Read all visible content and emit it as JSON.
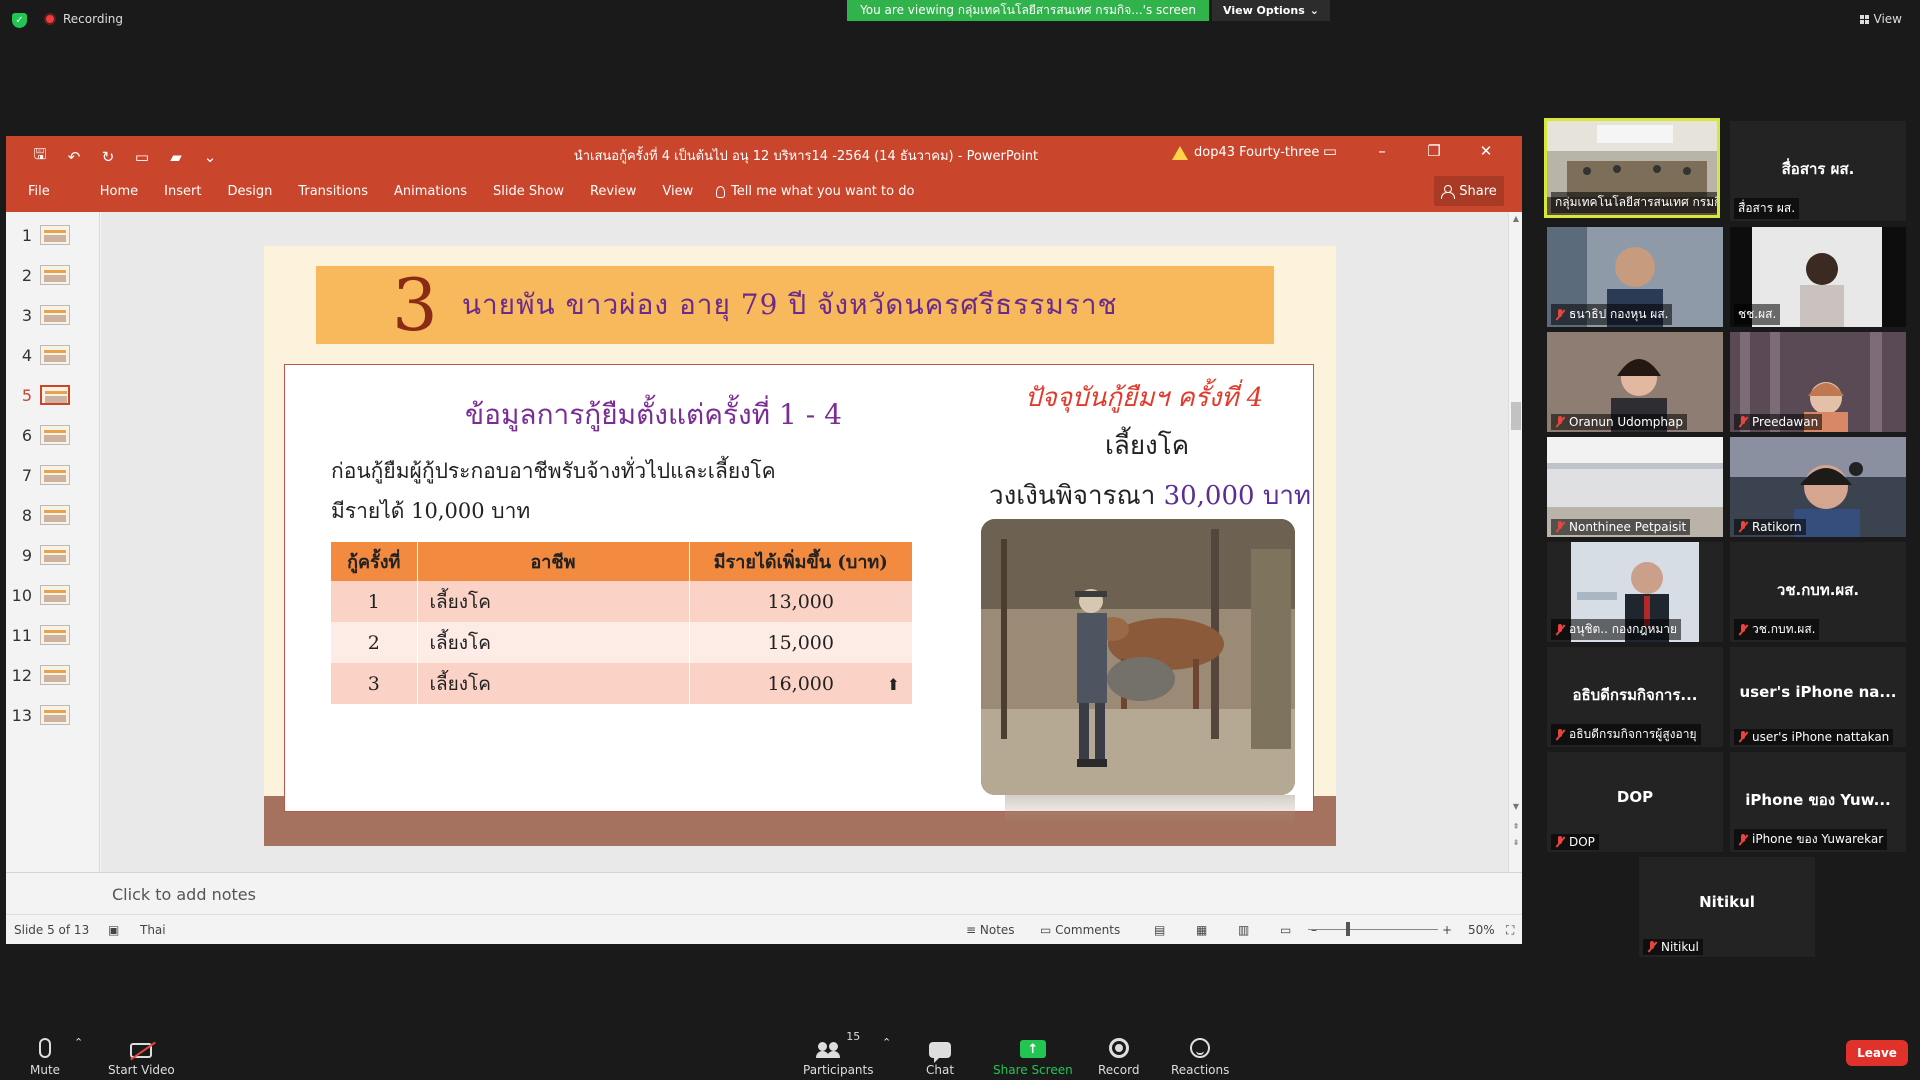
{
  "zoom": {
    "recording_label": "Recording",
    "banner_text": "You are viewing กลุ่มเทคโนโลยีสารสนเทศ กรมกิจ...'s screen",
    "view_options_label": "View Options",
    "view_label": "View",
    "participants_count": "15",
    "toolbar": {
      "mute": "Mute",
      "start_video": "Start Video",
      "participants": "Participants",
      "chat": "Chat",
      "share_screen": "Share Screen",
      "record": "Record",
      "reactions": "Reactions",
      "leave": "Leave"
    },
    "colors": {
      "accent_green": "#2fb34a",
      "leave_red": "#e0322b",
      "active_speaker": "#d8e83a"
    }
  },
  "powerpoint": {
    "doc_title": "นำเสนอกู้ครั้งที่ 4 เป็นต้นไป อนุ 12 บริหาร14 -2564 (14 ธันวาคม)  -  PowerPoint",
    "user": "dop43 Fourty-three",
    "menu": [
      "File",
      "Home",
      "Insert",
      "Design",
      "Transitions",
      "Animations",
      "Slide Show",
      "Review",
      "View"
    ],
    "tell_me": "Tell me what you want to do",
    "share": "Share",
    "slide_numbers": [
      "1",
      "2",
      "3",
      "4",
      "5",
      "6",
      "7",
      "8",
      "9",
      "10",
      "11",
      "12",
      "13"
    ],
    "active_slide": "5",
    "notes_placeholder": "Click to add notes",
    "status": {
      "slide_of": "Slide 5 of 13",
      "language": "Thai",
      "notes": "Notes",
      "comments": "Comments",
      "zoom": "50%"
    },
    "colors": {
      "title_bar": "#c9452c"
    }
  },
  "slide": {
    "number": "3",
    "heading": "นายพัน  ขาวผ่อง  อายุ 79 ปี  จังหวัดนครศรีธรรมราช",
    "subtitle": "ข้อมูลการกู้ยืมตั้งแต่ครั้งที่ 1 - 4",
    "line1": "ก่อนกู้ยืมผู้กู้ประกอบอาชีพรับจ้างทั่วไปและเลี้ยงโค",
    "line2": "มีรายได้  10,000 บาท",
    "table": {
      "headers": [
        "กู้ครั้งที่",
        "อาชีพ",
        "มีรายได้เพิ่มขึ้น  (บาท)"
      ],
      "rows": [
        {
          "no": "1",
          "occupation": "เลี้ยงโค",
          "income": "13,000"
        },
        {
          "no": "2",
          "occupation": "เลี้ยงโค",
          "income": "15,000"
        },
        {
          "no": "3",
          "occupation": "เลี้ยงโค",
          "income": "16,000"
        }
      ]
    },
    "current_label": "ปัจจุบันกู้ยืมฯ ครั้งที่ 4",
    "current_occupation": "เลี้ยงโค",
    "amount_label": "วงเงินพิจารณา",
    "amount_value": "30,000 บาท"
  },
  "participants": [
    {
      "name": "กลุ่มเทคโนโลยีสารสนเทศ กรมกิจ...",
      "type": "video",
      "active": true
    },
    {
      "name": "สื่อสาร ผส.",
      "display": "สื่อสาร ผส.",
      "type": "name"
    },
    {
      "name": "ธนาธิป กองหุน ผส.",
      "type": "video",
      "muted": true
    },
    {
      "name": "ชช.ผส.",
      "type": "video"
    },
    {
      "name": "Oranun Udomphap",
      "type": "video",
      "muted": true
    },
    {
      "name": "Preedawan",
      "type": "video",
      "muted": true
    },
    {
      "name": "Nonthinee Petpaisit",
      "type": "video",
      "muted": true
    },
    {
      "name": "Ratikorn",
      "type": "video",
      "muted": true
    },
    {
      "name": "อนุชิต.. กองกฎหมาย",
      "type": "video",
      "muted": true
    },
    {
      "name": "วช.กบท.ผส.",
      "display": "วช.กบท.ผส.",
      "type": "name",
      "muted": true
    },
    {
      "name": "อธิบดีกรมกิจการผู้สูงอายุ",
      "display": "อธิบดีกรมกิจการ...",
      "type": "name",
      "muted": true
    },
    {
      "name": "user's iPhone nattakan",
      "display": "user's iPhone na...",
      "type": "name",
      "muted": true
    },
    {
      "name": "DOP",
      "display": "DOP",
      "type": "name",
      "muted": true
    },
    {
      "name": "iPhone ของ Yuwarekar",
      "display": "iPhone ของ Yuw...",
      "type": "name",
      "muted": true
    },
    {
      "name": "Nitikul",
      "display": "Nitikul",
      "type": "name",
      "muted": true
    }
  ]
}
